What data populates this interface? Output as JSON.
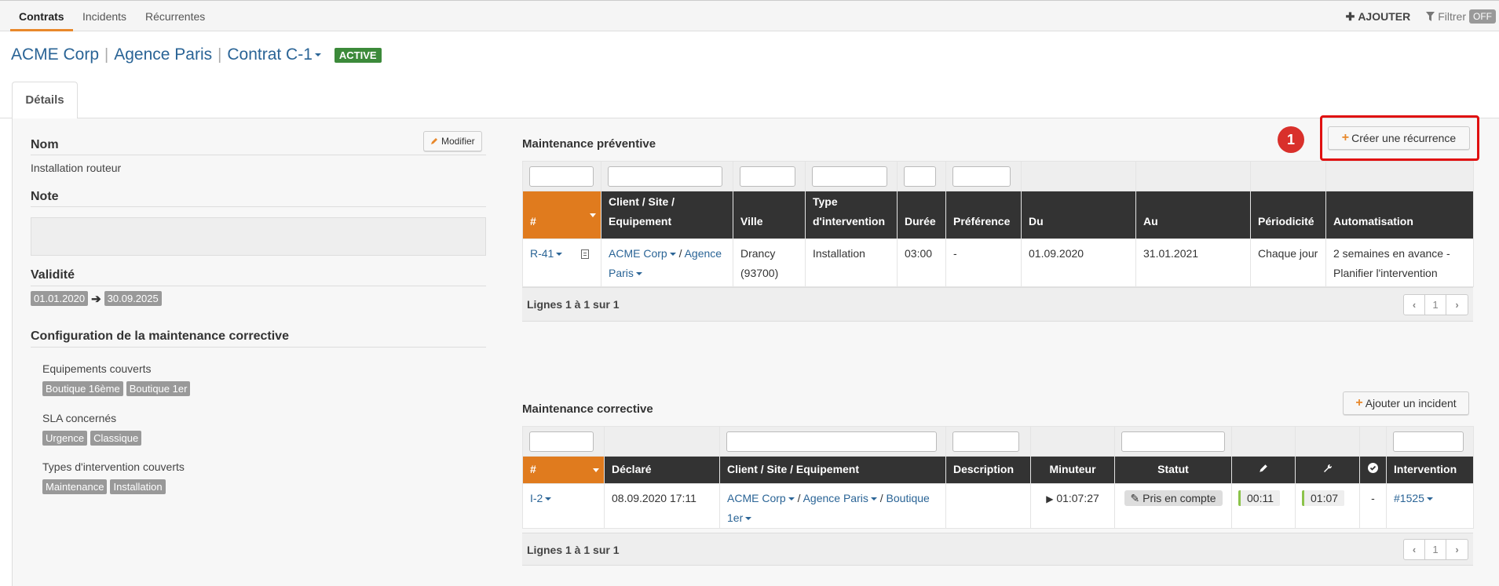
{
  "nav": {
    "tabs": [
      "Contrats",
      "Incidents",
      "Récurrentes"
    ],
    "add_label": "AJOUTER",
    "filter_label": "Filtrer",
    "filter_state": "OFF"
  },
  "breadcrumb": {
    "client": "ACME Corp",
    "site": "Agence Paris",
    "contract": "Contrat C-1",
    "status": "ACTIVE"
  },
  "detail_tab": "Détails",
  "left": {
    "name_label": "Nom",
    "modify_label": "Modifier",
    "name_value": "Installation routeur",
    "note_label": "Note",
    "validity_label": "Validité",
    "validity_start": "01.01.2020",
    "validity_end": "30.09.2025",
    "corrective_config_label": "Configuration de la maintenance corrective",
    "equipment_label": "Equipements couverts",
    "equipment": [
      "Boutique 16ème",
      "Boutique 1er"
    ],
    "sla_label": "SLA concernés",
    "sla": [
      "Urgence",
      "Classique"
    ],
    "types_label": "Types d'intervention couverts",
    "types": [
      "Maintenance",
      "Installation"
    ]
  },
  "preventive": {
    "title": "Maintenance préventive",
    "create_label": "Créer une récurrence",
    "step_number": "1",
    "columns": [
      "#",
      "Client / Site / Equipement",
      "Ville",
      "Type d'intervention",
      "Durée",
      "Préférence",
      "Du",
      "Au",
      "Périodicité",
      "Automatisation"
    ],
    "row": {
      "id": "R-41",
      "client": "ACME Corp",
      "site": "Agence Paris",
      "ville": "Drancy (93700)",
      "type": "Installation",
      "duree": "03:00",
      "preference": "-",
      "du": "01.09.2020",
      "au": "31.01.2021",
      "periodicite": "Chaque jour",
      "automatisation": "2 semaines en avance - Planifier l'intervention"
    },
    "count_label": "Lignes 1 à 1 sur 1",
    "page": "1"
  },
  "corrective": {
    "title": "Maintenance corrective",
    "add_label": "Ajouter un incident",
    "columns": [
      "#",
      "Déclaré",
      "Client / Site / Equipement",
      "Description",
      "Minuteur",
      "Statut",
      "Intervention"
    ],
    "row": {
      "id": "I-2",
      "declared": "08.09.2020 17:11",
      "client": "ACME Corp",
      "site": "Agence Paris",
      "equipment": "Boutique 1er",
      "description": "",
      "timer": "01:07:27",
      "status": "Pris en compte",
      "edit_time": "00:11",
      "tool_time": "01:07",
      "check": "-",
      "intervention": "#1525"
    },
    "count_label": "Lignes 1 à 1 sur 1",
    "page": "1"
  }
}
